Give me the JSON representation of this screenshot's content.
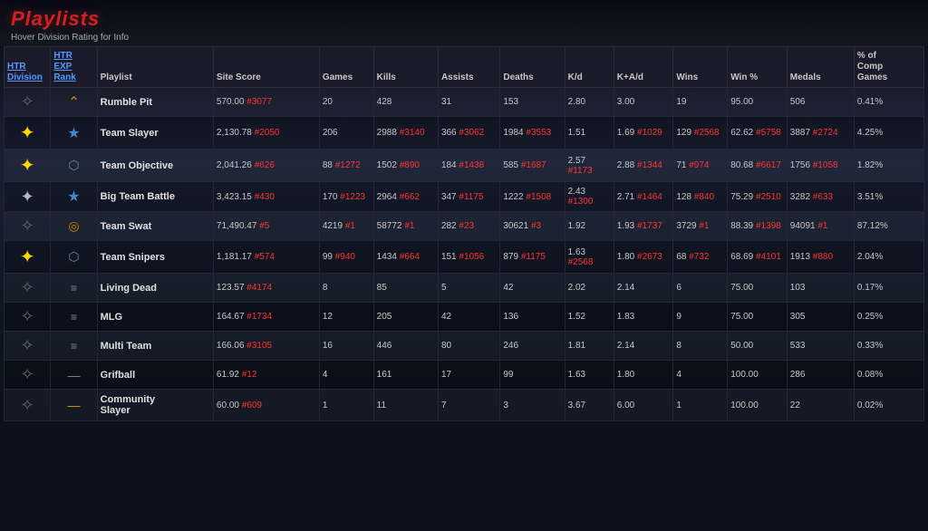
{
  "header": {
    "title": "Playlists",
    "subtitle": "Hover Division Rating for Info"
  },
  "columns": [
    {
      "key": "htr_division",
      "label": "HTR\nDivision"
    },
    {
      "key": "htr_exp",
      "label": "HTR\nEXP\nRank"
    },
    {
      "key": "playlist",
      "label": "Playlist"
    },
    {
      "key": "site_score",
      "label": "Site Score"
    },
    {
      "key": "games",
      "label": "Games"
    },
    {
      "key": "kills",
      "label": "Kills"
    },
    {
      "key": "assists",
      "label": "Assists"
    },
    {
      "key": "deaths",
      "label": "Deaths"
    },
    {
      "key": "kd",
      "label": "K/d"
    },
    {
      "key": "kad",
      "label": "K+A/d"
    },
    {
      "key": "wins",
      "label": "Wins"
    },
    {
      "key": "win_pct",
      "label": "Win %"
    },
    {
      "key": "medals",
      "label": "Medals"
    },
    {
      "key": "pct_comp",
      "label": "% of\nComp\nGames"
    }
  ],
  "rows": [
    {
      "div_icon": "plain",
      "rank_icon": "chevron",
      "playlist": "Rumble Pit",
      "site_score": "570.00",
      "site_score_rank": "#3077",
      "games": "20",
      "kills": "428",
      "kills_rank": "",
      "assists": "31",
      "assists_rank": "",
      "deaths": "153",
      "deaths_rank": "",
      "kd": "2.80",
      "kd_rank": "",
      "kad": "3.00",
      "kad_rank": "",
      "wins": "19",
      "wins_rank": "",
      "win_pct": "95.00",
      "win_pct_rank": "",
      "medals": "506",
      "medals_rank": "",
      "pct_comp": "0.41%"
    },
    {
      "div_icon": "gold",
      "rank_icon": "star-blue",
      "playlist": "Team Slayer",
      "site_score": "2,130.78",
      "site_score_rank": "#2050",
      "games": "206",
      "kills": "2988",
      "kills_rank": "#3140",
      "assists": "366",
      "assists_rank": "#3062",
      "deaths": "1984",
      "deaths_rank": "#3553",
      "kd": "1.51",
      "kd_rank": "",
      "kad": "1.69",
      "kad_rank": "#1029",
      "wins": "129",
      "wins_rank": "#2568",
      "win_pct": "62.62",
      "win_pct_rank": "#5758",
      "medals": "3887",
      "medals_rank": "#2724",
      "pct_comp": "4.25%"
    },
    {
      "div_icon": "gold",
      "rank_icon": "shield",
      "playlist": "Team Objective",
      "site_score": "2,041.26",
      "site_score_rank": "#626",
      "games": "88",
      "games_rank": "#1272",
      "kills": "1502",
      "kills_rank": "#890",
      "assists": "184",
      "assists_rank": "#1438",
      "deaths": "585",
      "deaths_rank": "#1687",
      "kd": "2.57",
      "kd_rank": "#1173",
      "kad": "2.88",
      "kad_rank": "#1344",
      "wins": "71",
      "wins_rank": "#974",
      "win_pct": "80.68",
      "win_pct_rank": "#6617",
      "medals": "1756",
      "medals_rank": "#1058",
      "pct_comp": "1.82%"
    },
    {
      "div_icon": "silver",
      "rank_icon": "star-blue",
      "playlist": "Big Team Battle",
      "site_score": "3,423.15",
      "site_score_rank": "#430",
      "games": "170",
      "games_rank": "#1223",
      "kills": "2964",
      "kills_rank": "#662",
      "assists": "347",
      "assists_rank": "#1175",
      "deaths": "1222",
      "deaths_rank": "#1508",
      "kd": "2.43",
      "kd_rank": "#1300",
      "kad": "2.71",
      "kad_rank": "#1464",
      "wins": "128",
      "wins_rank": "#840",
      "win_pct": "75.29",
      "win_pct_rank": "#2510",
      "medals": "3282",
      "medals_rank": "#633",
      "pct_comp": "3.51%"
    },
    {
      "div_icon": "plain",
      "rank_icon": "circle",
      "playlist": "Team Swat",
      "site_score": "71,490.47",
      "site_score_rank": "#5",
      "games": "4219",
      "games_rank": "#1",
      "kills": "58772",
      "kills_rank": "#1",
      "assists": "282",
      "assists_rank": "#23",
      "deaths": "30621",
      "deaths_rank": "#3",
      "kd": "1.92",
      "kd_rank": "",
      "kad": "1.93",
      "kad_rank": "#1737",
      "wins": "3729",
      "wins_rank": "#1",
      "win_pct": "88.39",
      "win_pct_rank": "#1398",
      "medals": "94091",
      "medals_rank": "#1",
      "pct_comp": "87.12%"
    },
    {
      "div_icon": "gold",
      "rank_icon": "shield",
      "playlist": "Team Snipers",
      "site_score": "1,181.17",
      "site_score_rank": "#574",
      "games": "99",
      "games_rank": "#940",
      "kills": "1434",
      "kills_rank": "#664",
      "assists": "151",
      "assists_rank": "#1056",
      "deaths": "879",
      "deaths_rank": "#1175",
      "kd": "1.63",
      "kd_rank": "#2568",
      "kad": "1.80",
      "kad_rank": "#2673",
      "wins": "68",
      "wins_rank": "#732",
      "win_pct": "68.69",
      "win_pct_rank": "#4101",
      "medals": "1913",
      "medals_rank": "#880",
      "pct_comp": "2.04%"
    },
    {
      "div_icon": "plain",
      "rank_icon": "lines2",
      "playlist": "Living Dead",
      "site_score": "123.57",
      "site_score_rank": "#4174",
      "games": "8",
      "games_rank": "",
      "kills": "85",
      "kills_rank": "",
      "assists": "5",
      "assists_rank": "",
      "deaths": "42",
      "deaths_rank": "",
      "kd": "2.02",
      "kd_rank": "",
      "kad": "2.14",
      "kad_rank": "",
      "wins": "6",
      "wins_rank": "",
      "win_pct": "75.00",
      "win_pct_rank": "",
      "medals": "103",
      "medals_rank": "",
      "pct_comp": "0.17%"
    },
    {
      "div_icon": "plain",
      "rank_icon": "lines2",
      "playlist": "MLG",
      "site_score": "164.67",
      "site_score_rank": "#1734",
      "games": "12",
      "games_rank": "",
      "kills": "205",
      "kills_rank": "",
      "assists": "42",
      "assists_rank": "",
      "deaths": "136",
      "deaths_rank": "",
      "kd": "1.52",
      "kd_rank": "",
      "kad": "1.83",
      "kad_rank": "",
      "wins": "9",
      "wins_rank": "",
      "win_pct": "75.00",
      "win_pct_rank": "",
      "medals": "305",
      "medals_rank": "",
      "pct_comp": "0.25%"
    },
    {
      "div_icon": "plain",
      "rank_icon": "lines2",
      "playlist": "Multi Team",
      "site_score": "166.06",
      "site_score_rank": "#3105",
      "games": "16",
      "games_rank": "",
      "kills": "446",
      "kills_rank": "",
      "assists": "80",
      "assists_rank": "",
      "deaths": "246",
      "deaths_rank": "",
      "kd": "1.81",
      "kd_rank": "",
      "kad": "2.14",
      "kad_rank": "",
      "wins": "8",
      "wins_rank": "",
      "win_pct": "50.00",
      "win_pct_rank": "",
      "medals": "533",
      "medals_rank": "",
      "pct_comp": "0.33%"
    },
    {
      "div_icon": "plain",
      "rank_icon": "single",
      "playlist": "Grifball",
      "site_score": "61.92",
      "site_score_rank": "#12",
      "games": "4",
      "games_rank": "",
      "kills": "161",
      "kills_rank": "",
      "assists": "17",
      "assists_rank": "",
      "deaths": "99",
      "deaths_rank": "",
      "kd": "1.63",
      "kd_rank": "",
      "kad": "1.80",
      "kad_rank": "",
      "wins": "4",
      "wins_rank": "",
      "win_pct": "100.00",
      "win_pct_rank": "",
      "medals": "286",
      "medals_rank": "",
      "pct_comp": "0.08%"
    },
    {
      "div_icon": "plain",
      "rank_icon": "single-gold",
      "playlist": "Community\nSlayer",
      "site_score": "60.00",
      "site_score_rank": "#609",
      "games": "1",
      "games_rank": "",
      "kills": "11",
      "kills_rank": "",
      "assists": "7",
      "assists_rank": "",
      "deaths": "3",
      "deaths_rank": "",
      "kd": "3.67",
      "kd_rank": "",
      "kad": "6.00",
      "kad_rank": "",
      "wins": "1",
      "wins_rank": "",
      "win_pct": "100.00",
      "win_pct_rank": "",
      "medals": "22",
      "medals_rank": "",
      "pct_comp": "0.02%"
    }
  ]
}
